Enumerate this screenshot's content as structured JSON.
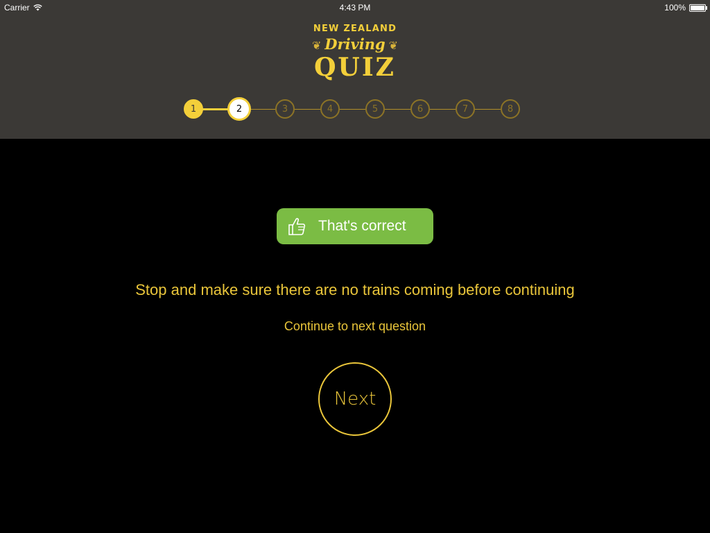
{
  "status_bar": {
    "carrier": "Carrier",
    "time": "4:43 PM",
    "battery": "100%"
  },
  "logo": {
    "line1": "NEW ZEALAND",
    "line2": "Driving",
    "line3": "QUIZ"
  },
  "progress": {
    "steps": [
      "1",
      "2",
      "3",
      "4",
      "5",
      "6",
      "7",
      "8"
    ],
    "completed": 1,
    "current": 2
  },
  "feedback": {
    "label": "That's correct",
    "icon": "thumbs-up-icon",
    "color": "#7bbc44"
  },
  "explanation": "Stop and make sure there are no trains coming before continuing",
  "continue_text": "Continue to next question",
  "next_button": "Next",
  "colors": {
    "accent": "#f3cf3a",
    "header_bg": "#3b3936",
    "background": "#000000",
    "success": "#7bbc44"
  }
}
